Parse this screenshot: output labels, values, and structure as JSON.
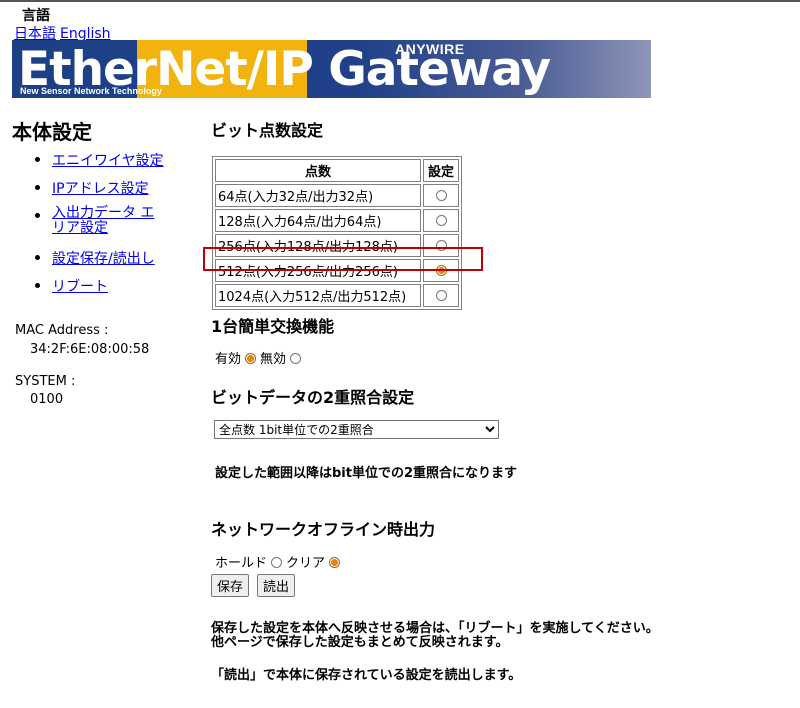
{
  "language": {
    "title": "言語",
    "links": [
      "日本語",
      "English"
    ]
  },
  "banner": {
    "title": "EtherNet/IP Gateway",
    "subtitle": "New Sensor Network Technology",
    "brand": "ANYWIRE"
  },
  "sidebar": {
    "title": "本体設定",
    "items": [
      {
        "label": "エニイワイヤ設定"
      },
      {
        "label": "IPアドレス設定"
      },
      {
        "label": "入出力データ エリア設定"
      },
      {
        "label": "設定保存/読出し"
      },
      {
        "label": "リブート"
      }
    ],
    "mac_label": "MAC Address :",
    "mac_value": "34:2F:6E:08:00:58",
    "system_label": "SYSTEM :",
    "system_value": "0100"
  },
  "bit_settings": {
    "heading": "ビット点数設定",
    "columns": [
      "点数",
      "設定"
    ],
    "rows": [
      {
        "label": "64点(入力32点/出力32点)",
        "selected": false
      },
      {
        "label": "128点(入力64点/出力64点)",
        "selected": false
      },
      {
        "label": "256点(入力128点/出力128点)",
        "selected": false
      },
      {
        "label": "512点(入力256点/出力256点)",
        "selected": true
      },
      {
        "label": "1024点(入力512点/出力512点)",
        "selected": false
      }
    ]
  },
  "simple_exchange": {
    "heading": "1台簡単交換機能",
    "options": [
      {
        "label": "有効",
        "selected": true
      },
      {
        "label": "無効",
        "selected": false
      }
    ]
  },
  "double_check": {
    "heading": "ビットデータの2重照合設定",
    "selected_value": "全点数 1bit単位での2重照合",
    "note": "設定した範囲以降はbit単位での2重照合になります"
  },
  "offline_output": {
    "heading": "ネットワークオフライン時出力",
    "options": [
      {
        "label": "ホールド",
        "selected": false
      },
      {
        "label": "クリア",
        "selected": true
      }
    ]
  },
  "buttons": {
    "save": "保存",
    "read": "読出"
  },
  "messages": {
    "line1": "保存した設定を本体へ反映させる場合は、「リブート」を実施してください。",
    "line2": "他ページで保存した設定もまとめて反映されます。",
    "line3": "「読出」で本体に保存されている設定を読出します。"
  },
  "colors": {
    "accent_radio": "#e6860c",
    "highlight_box": "#c00000",
    "link": "#0000ee"
  }
}
